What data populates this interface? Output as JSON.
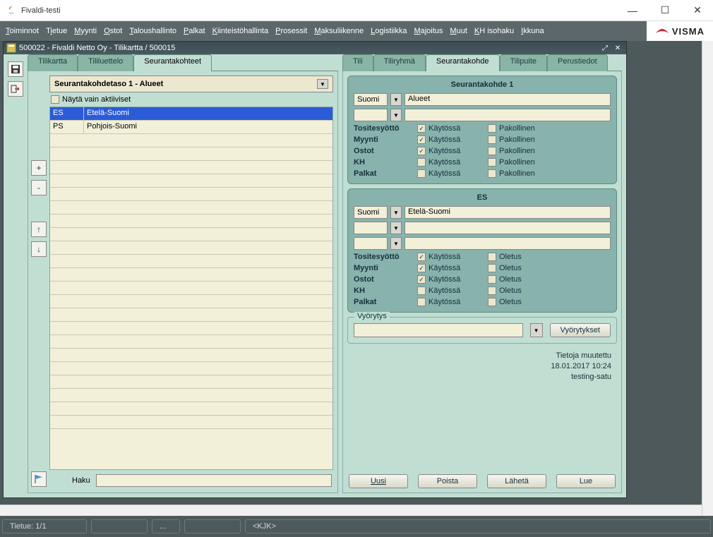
{
  "window": {
    "title": "Fivaldi-testi"
  },
  "menus": [
    "Toiminnot",
    "Tietue",
    "Myynti",
    "Ostot",
    "Taloushallinto",
    "Palkat",
    "Kiinteistöhallinta",
    "Prosessit",
    "Maksuliikenne",
    "Logistiikka",
    "Majoitus",
    "Muut",
    "KH isohaku",
    "Ikkuna"
  ],
  "brand": "VISMA",
  "inner_title": "500022 - Fivaldi Netto Oy - Tilikartta / 500015",
  "left_tabs": [
    "Tilikartta",
    "Tililuettelo",
    "Seurantakohteet"
  ],
  "right_tabs": [
    "Tili",
    "Tiliryhmä",
    "Seurantakohde",
    "Tilipuite",
    "Perustiedot"
  ],
  "left": {
    "level_label": "Seurantakohdetaso 1 - Alueet",
    "chk_label": "Näytä vain aktiiviset",
    "rows": [
      {
        "code": "ES",
        "name": "Etelä-Suomi"
      },
      {
        "code": "PS",
        "name": "Pohjois-Suomi"
      }
    ],
    "haku_label": "Haku"
  },
  "r1": {
    "title": "Seurantakohde 1",
    "lang": "Suomi",
    "name": "Alueet",
    "labels": [
      "Tositesyöttö",
      "Myynti",
      "Ostot",
      "KH",
      "Palkat"
    ],
    "col1": "Käytössä",
    "col2": "Pakollinen",
    "c1": [
      true,
      true,
      true,
      false,
      false
    ],
    "c2": [
      false,
      false,
      false,
      false,
      false
    ]
  },
  "r2": {
    "title": "ES",
    "lang": "Suomi",
    "name": "Etelä-Suomi",
    "labels": [
      "Tositesyöttö",
      "Myynti",
      "Ostot",
      "KH",
      "Palkat"
    ],
    "col1": "Käytössä",
    "col2": "Oletus",
    "c1": [
      true,
      true,
      true,
      false,
      false
    ],
    "c2": [
      false,
      false,
      false,
      false,
      false
    ]
  },
  "vyorytys": {
    "label": "Vyörytys",
    "btn": "Vyörytykset"
  },
  "info": {
    "l1": "Tietoja muutettu",
    "l2": "18.01.2017 10:24",
    "l3": "testing-satu"
  },
  "buttons": {
    "uusi": "Uusi",
    "poista": "Poista",
    "laheta": "Lähetä",
    "lue": "Lue"
  },
  "status": {
    "tietue": "Tietue: 1/1",
    "dots": "...",
    "user": "<KJK>"
  }
}
